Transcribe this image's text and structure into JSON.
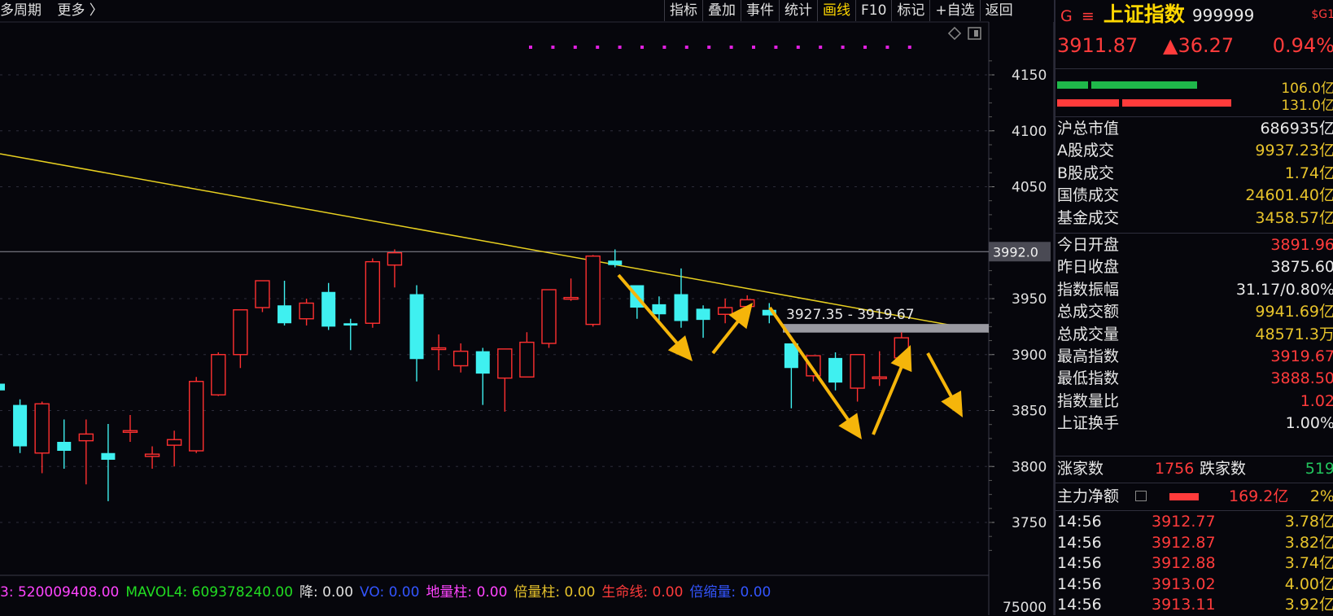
{
  "top_bar": {
    "period": "多周期",
    "more": "更多 〉"
  },
  "toolbar": [
    "指标",
    "叠加",
    "事件",
    "统计",
    "画线",
    "F10",
    "标记",
    "+自选",
    "返回"
  ],
  "toolbar_active": "画线",
  "chart_data": {
    "type": "candlestick",
    "y_ticks": [
      4150,
      4100,
      4050,
      3950,
      3900,
      3850,
      3800,
      3750
    ],
    "price_marker": "3992.0",
    "volume_tick": "75000",
    "range_annotation": "3927.35 - 3919.67",
    "candles": [
      {
        "o": 3874,
        "h": 3878,
        "l": 3860,
        "c": 3868
      },
      {
        "o": 3855,
        "h": 3860,
        "l": 3812,
        "c": 3818
      },
      {
        "o": 3812,
        "h": 3858,
        "l": 3794,
        "c": 3856
      },
      {
        "o": 3822,
        "h": 3842,
        "l": 3798,
        "c": 3814
      },
      {
        "o": 3823,
        "h": 3842,
        "l": 3784,
        "c": 3829
      },
      {
        "o": 3812,
        "h": 3838,
        "l": 3769,
        "c": 3806
      },
      {
        "o": 3832,
        "h": 3846,
        "l": 3822,
        "c": 3832
      },
      {
        "o": 3809,
        "h": 3818,
        "l": 3798,
        "c": 3811
      },
      {
        "o": 3819,
        "h": 3832,
        "l": 3800,
        "c": 3824
      },
      {
        "o": 3814,
        "h": 3880,
        "l": 3812,
        "c": 3876
      },
      {
        "o": 3864,
        "h": 3902,
        "l": 3863,
        "c": 3900
      },
      {
        "o": 3900,
        "h": 3940,
        "l": 3888,
        "c": 3940
      },
      {
        "o": 3942,
        "h": 3966,
        "l": 3938,
        "c": 3966
      },
      {
        "o": 3944,
        "h": 3966,
        "l": 3926,
        "c": 3928
      },
      {
        "o": 3932,
        "h": 3950,
        "l": 3926,
        "c": 3946
      },
      {
        "o": 3956,
        "h": 3964,
        "l": 3922,
        "c": 3925
      },
      {
        "o": 3928,
        "h": 3932,
        "l": 3904,
        "c": 3926
      },
      {
        "o": 3928,
        "h": 3986,
        "l": 3924,
        "c": 3983
      },
      {
        "o": 3980,
        "h": 3994,
        "l": 3960,
        "c": 3991
      },
      {
        "o": 3954,
        "h": 3962,
        "l": 3876,
        "c": 3896
      },
      {
        "o": 3906,
        "h": 3918,
        "l": 3886,
        "c": 3906
      },
      {
        "o": 3890,
        "h": 3910,
        "l": 3884,
        "c": 3903
      },
      {
        "o": 3903,
        "h": 3906,
        "l": 3855,
        "c": 3883
      },
      {
        "o": 3879,
        "h": 3893,
        "l": 3849,
        "c": 3905
      },
      {
        "o": 3880,
        "h": 3920,
        "l": 3880,
        "c": 3911
      },
      {
        "o": 3910,
        "h": 3958,
        "l": 3906,
        "c": 3958
      },
      {
        "o": 3950,
        "h": 3968,
        "l": 3948,
        "c": 3951
      },
      {
        "o": 3927,
        "h": 3989,
        "l": 3925,
        "c": 3988
      },
      {
        "o": 3984,
        "h": 3994,
        "l": 3978,
        "c": 3980
      },
      {
        "o": 3962,
        "h": 3962,
        "l": 3932,
        "c": 3942
      },
      {
        "o": 3945,
        "h": 3952,
        "l": 3930,
        "c": 3936
      },
      {
        "o": 3954,
        "h": 3977,
        "l": 3924,
        "c": 3930
      },
      {
        "o": 3941,
        "h": 3944,
        "l": 3915,
        "c": 3931
      },
      {
        "o": 3936,
        "h": 3950,
        "l": 3928,
        "c": 3942
      },
      {
        "o": 3943,
        "h": 3953,
        "l": 3934,
        "c": 3949
      },
      {
        "o": 3940,
        "h": 3946,
        "l": 3928,
        "c": 3935
      },
      {
        "o": 3910,
        "h": 3910,
        "l": 3852,
        "c": 3888
      },
      {
        "o": 3881,
        "h": 3899,
        "l": 3876,
        "c": 3899
      },
      {
        "o": 3897,
        "h": 3902,
        "l": 3868,
        "c": 3875
      },
      {
        "o": 3870,
        "h": 3900,
        "l": 3858,
        "c": 3900
      },
      {
        "o": 3880,
        "h": 3903,
        "l": 3872,
        "c": 3880
      },
      {
        "o": 3897,
        "h": 3920,
        "l": 3889,
        "c": 3915
      }
    ]
  },
  "indicator_bar": [
    {
      "label": "3: 520009408.00",
      "color": "#ff44ff"
    },
    {
      "label": "MAVOL4: 609378240.00",
      "color": "#22dd22"
    },
    {
      "label": "降: 0.00",
      "color": "#e0e0e0"
    },
    {
      "label": "VO: 0.00",
      "color": "#3355ff"
    },
    {
      "label": "地量柱: 0.00",
      "color": "#ff44ff"
    },
    {
      "label": "倍量柱: 0.00",
      "color": "#e7c32b"
    },
    {
      "label": "生命线: 0.00",
      "color": "#ff3b3b"
    },
    {
      "label": "倍缩量: 0.00",
      "color": "#3355ff"
    }
  ],
  "panel": {
    "badge_g": "G",
    "menu_glyph": "≡",
    "title": "上证指数",
    "code": "999999",
    "badge_sg": "$G1",
    "price": "3911.87",
    "change": "▲36.27",
    "pct": "0.94%",
    "bar_green_val": "106.0亿",
    "bar_red_val": "131.0亿",
    "stats_a": [
      {
        "label": "沪总市值",
        "value": "686935亿",
        "color": "wht"
      },
      {
        "label": "A股成交",
        "value": "9937.23亿",
        "color": "yel"
      },
      {
        "label": "B股成交",
        "value": "1.74亿",
        "color": "yel"
      },
      {
        "label": "国债成交",
        "value": "24601.40亿",
        "color": "yel"
      },
      {
        "label": "基金成交",
        "value": "3458.57亿",
        "color": "yel"
      }
    ],
    "stats_b": [
      {
        "label": "今日开盘",
        "value": "3891.96",
        "color": "red"
      },
      {
        "label": "昨日收盘",
        "value": "3875.60",
        "color": "wht"
      },
      {
        "label": "指数振幅",
        "value": "31.17/0.80%",
        "color": "wht"
      },
      {
        "label": "总成交额",
        "value": "9941.69亿",
        "color": "yel"
      },
      {
        "label": "总成交量",
        "value": "48571.3万",
        "color": "yel"
      },
      {
        "label": "最高指数",
        "value": "3919.67",
        "color": "red"
      },
      {
        "label": "最低指数",
        "value": "3888.50",
        "color": "red"
      },
      {
        "label": "指数量比",
        "value": "1.02",
        "color": "red"
      },
      {
        "label": "上证换手",
        "value": "1.00%",
        "color": "wht"
      }
    ],
    "up_label": "涨家数",
    "up_value": "1756",
    "down_label": "跌家数",
    "down_value": "519",
    "main_flow_label": "主力净额",
    "main_flow_value": "169.2亿",
    "main_flow_pct": "2%",
    "ticks": [
      {
        "t": "14:56",
        "p": "3912.77",
        "v": "3.78亿"
      },
      {
        "t": "14:56",
        "p": "3912.87",
        "v": "3.82亿"
      },
      {
        "t": "14:56",
        "p": "3912.88",
        "v": "3.74亿"
      },
      {
        "t": "14:56",
        "p": "3913.02",
        "v": "4.00亿"
      },
      {
        "t": "14:56",
        "p": "3913.11",
        "v": "3.92亿"
      }
    ]
  }
}
